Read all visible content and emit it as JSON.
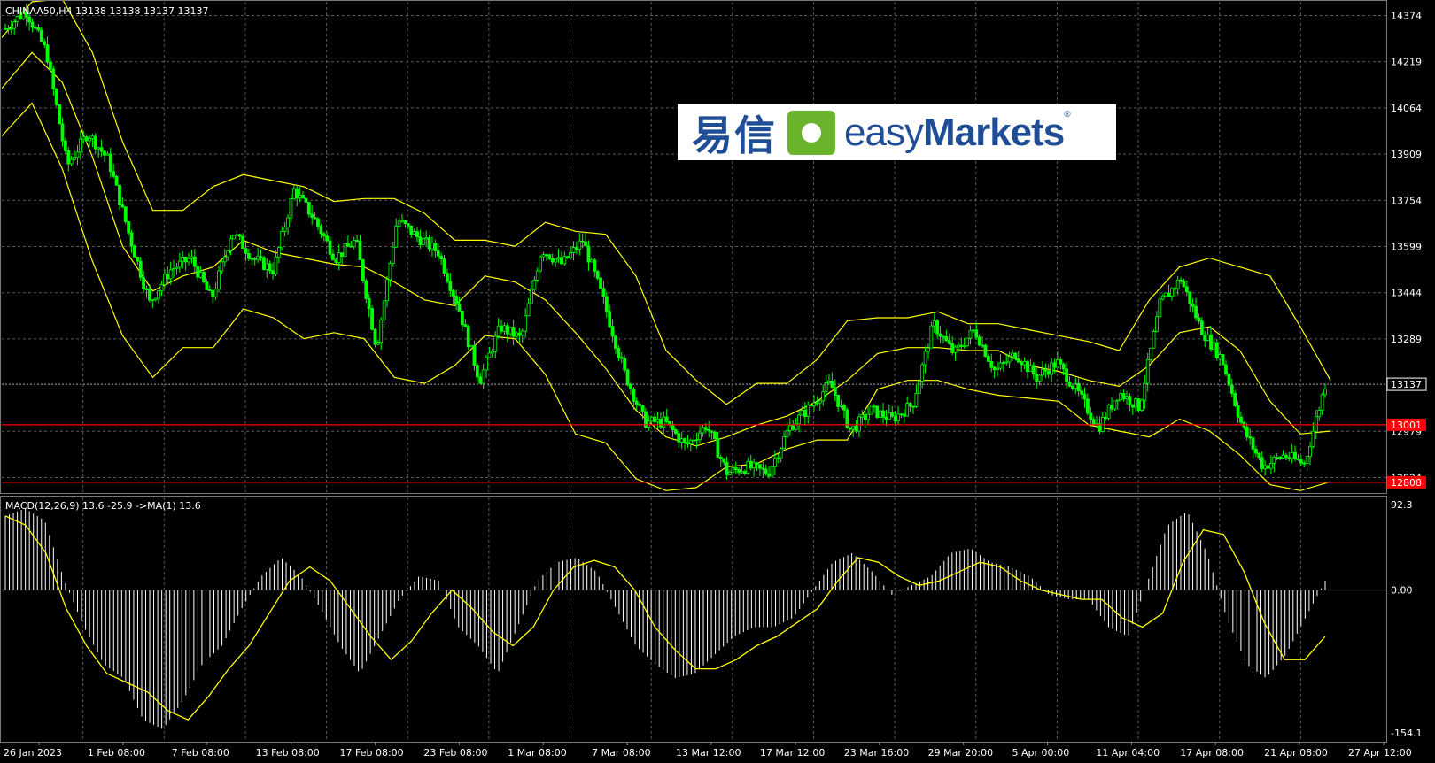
{
  "header": {
    "symbol_text": "CHINAA50,H4  13138 13138 13137 13137",
    "macd_text": "MACD(12,26,9) 13.6 -25.9  ->MA(1) 13.6"
  },
  "logo": {
    "cn": "易信",
    "en_light": "easy",
    "en_bold": "Markets",
    "reg": "®"
  },
  "colors": {
    "bg": "#000000",
    "grid": "#5a5a5a",
    "candle": "#00ff00",
    "band": "#ffff00",
    "hline": "#ff0000",
    "hist": "#ffffff"
  },
  "chart_data": {
    "type": "candlestick",
    "symbol": "CHINAA50",
    "timeframe": "H4",
    "price_axis_ticks": [
      14374,
      14219,
      14064,
      13909,
      13754,
      13599,
      13444,
      13289,
      12979,
      12824
    ],
    "price_range": [
      12775,
      14420
    ],
    "current_price": 13137,
    "price_levels": [
      13001,
      12808
    ],
    "time_labels": [
      "26 Jan 2023",
      "1 Feb 08:00",
      "7 Feb 08:00",
      "13 Feb 08:00",
      "17 Feb 08:00",
      "23 Feb 08:00",
      "1 Mar 08:00",
      "7 Mar 08:00",
      "13 Mar 12:00",
      "17 Mar 12:00",
      "23 Mar 16:00",
      "29 Mar 20:00",
      "5 Apr 00:00",
      "11 Apr 04:00",
      "17 Apr 08:00",
      "21 Apr 08:00",
      "27 Apr 12:00"
    ],
    "close_path": [
      14330,
      14390,
      14250,
      13870,
      13980,
      13890,
      13640,
      13410,
      13520,
      13560,
      13420,
      13650,
      13560,
      13520,
      13790,
      13690,
      13560,
      13620,
      13260,
      13690,
      13630,
      13580,
      13390,
      13150,
      13330,
      13290,
      13590,
      13540,
      13620,
      13420,
      13180,
      13010,
      13010,
      12930,
      13000,
      12840,
      12860,
      12840,
      12990,
      13060,
      13140,
      12980,
      13050,
      13020,
      13070,
      13340,
      13240,
      13320,
      13180,
      13240,
      13160,
      13210,
      13110,
      12990,
      13110,
      13060,
      13410,
      13490,
      13320,
      13220,
      12990,
      12860,
      12900,
      12870,
      13137
    ],
    "bollinger": {
      "upper": [
        14300,
        14420,
        14430,
        14250,
        13950,
        13720,
        13720,
        13800,
        13840,
        13820,
        13800,
        13750,
        13760,
        13760,
        13710,
        13620,
        13620,
        13600,
        13680,
        13650,
        13640,
        13500,
        13250,
        13150,
        13070,
        13140,
        13140,
        13220,
        13350,
        13360,
        13360,
        13380,
        13340,
        13340,
        13320,
        13300,
        13280,
        13250,
        13420,
        13530,
        13560,
        13530,
        13500,
        13330,
        13150
      ],
      "middle": [
        14130,
        14250,
        14150,
        13900,
        13600,
        13450,
        13500,
        13530,
        13620,
        13580,
        13560,
        13540,
        13530,
        13480,
        13420,
        13400,
        13500,
        13480,
        13420,
        13310,
        13190,
        13050,
        12960,
        12930,
        12960,
        13000,
        13030,
        13080,
        13150,
        13240,
        13260,
        13260,
        13250,
        13250,
        13200,
        13180,
        13150,
        13130,
        13200,
        13310,
        13330,
        13250,
        13080,
        12970,
        12980
      ],
      "lower": [
        13970,
        14080,
        13860,
        13550,
        13300,
        13160,
        13260,
        13260,
        13390,
        13360,
        13290,
        13310,
        13290,
        13160,
        13140,
        13200,
        13300,
        13290,
        13170,
        12970,
        12940,
        12820,
        12780,
        12790,
        12860,
        12870,
        12920,
        12950,
        12950,
        13120,
        13150,
        13150,
        13120,
        13100,
        13090,
        13080,
        13000,
        12980,
        12960,
        13020,
        12980,
        12900,
        12800,
        12780,
        12810
      ]
    },
    "macd_axis_ticks": [
      92.3,
      0.0,
      -154.1
    ],
    "macd_range": [
      -154.1,
      92.3
    ],
    "macd_hist": [
      80,
      88,
      75,
      10,
      -40,
      -80,
      -95,
      -140,
      -150,
      -120,
      -80,
      -60,
      -20,
      15,
      35,
      15,
      -20,
      -60,
      -90,
      -50,
      -10,
      15,
      10,
      -40,
      -60,
      -90,
      -40,
      10,
      30,
      35,
      20,
      -20,
      -60,
      -80,
      -95,
      -90,
      -70,
      -50,
      -40,
      -40,
      -30,
      0,
      30,
      40,
      20,
      -5,
      5,
      15,
      40,
      45,
      30,
      25,
      15,
      -5,
      -10,
      -10,
      -40,
      -50,
      10,
      70,
      85,
      40,
      -30,
      -80,
      -95,
      -70,
      -30,
      10
    ],
    "macd_signal": [
      80,
      70,
      40,
      -20,
      -60,
      -90,
      -100,
      -110,
      -130,
      -140,
      -115,
      -85,
      -60,
      -25,
      10,
      25,
      10,
      -20,
      -50,
      -75,
      -55,
      -25,
      0,
      -20,
      -45,
      -60,
      -40,
      0,
      25,
      32,
      25,
      0,
      -40,
      -65,
      -85,
      -85,
      -75,
      -60,
      -50,
      -35,
      -20,
      10,
      35,
      30,
      15,
      5,
      10,
      20,
      30,
      25,
      10,
      0,
      -5,
      -10,
      -10,
      -30,
      -40,
      -25,
      30,
      65,
      60,
      20,
      -35,
      -75,
      -75,
      -50
    ]
  }
}
